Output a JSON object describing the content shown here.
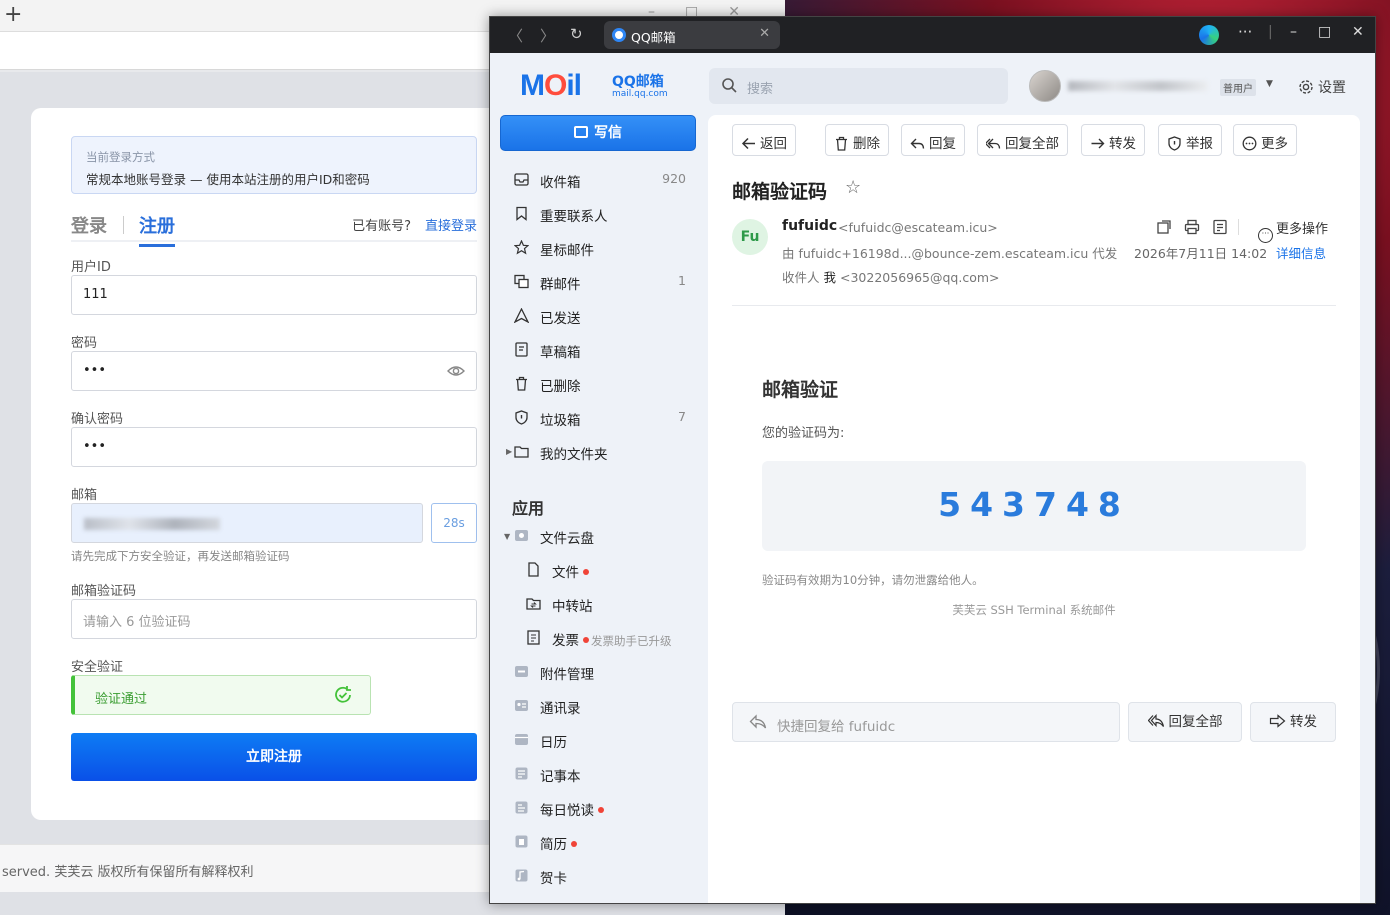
{
  "register": {
    "login_mode_title": "当前登录方式",
    "login_mode_desc": "常规本地账号登录 — 使用本站注册的用户ID和密码",
    "tab_login": "登录",
    "tab_register": "注册",
    "have_account": "已有账号?",
    "direct_login": "直接登录",
    "userid_label": "用户ID",
    "userid_value": "111",
    "password_label": "密码",
    "password_value": "•••",
    "confirm_label": "确认密码",
    "confirm_value": "•••",
    "email_label": "邮箱",
    "resend_countdown": "28s",
    "email_hint": "请先完成下方安全验证，再发送邮箱验证码",
    "code_label": "邮箱验证码",
    "code_placeholder": "请输入 6 位验证码",
    "security_label": "安全验证",
    "verify_status": "验证通过",
    "submit_label": "立即注册",
    "footer": "served. 芙芙云 版权所有保留所有解释权利"
  },
  "browser": {
    "tab_title": "QQ邮箱"
  },
  "header": {
    "logo_main": "MOil",
    "logo_brand": "QQ邮箱",
    "logo_domain": "mail.qq.com",
    "search_placeholder": "搜索",
    "user_level": "普用户",
    "settings_label": "设置"
  },
  "sidebar": {
    "compose_label": "写信",
    "items": [
      {
        "label": "收件箱",
        "count": "920"
      },
      {
        "label": "重要联系人",
        "count": ""
      },
      {
        "label": "星标邮件",
        "count": ""
      },
      {
        "label": "群邮件",
        "count": "1"
      },
      {
        "label": "已发送",
        "count": ""
      },
      {
        "label": "草稿箱",
        "count": ""
      },
      {
        "label": "已删除",
        "count": ""
      },
      {
        "label": "垃圾箱",
        "count": "7"
      },
      {
        "label": "我的文件夹",
        "count": ""
      }
    ],
    "apps_title": "应用",
    "apps": [
      {
        "label": "文件云盘"
      },
      {
        "label": "文件"
      },
      {
        "label": "中转站"
      },
      {
        "label": "发票",
        "note": "发票助手已升级"
      },
      {
        "label": "附件管理"
      },
      {
        "label": "通讯录"
      },
      {
        "label": "日历"
      },
      {
        "label": "记事本"
      },
      {
        "label": "每日悦读"
      },
      {
        "label": "简历"
      },
      {
        "label": "贺卡"
      }
    ]
  },
  "toolbar": {
    "back": "返回",
    "delete": "删除",
    "reply": "回复",
    "reply_all": "回复全部",
    "forward": "转发",
    "report": "举报",
    "more": "更多"
  },
  "mail": {
    "subject": "邮箱验证码",
    "sender_initials": "Fu",
    "sender_name": "fufuidc",
    "sender_addr": "<fufuidc@escateam.icu>",
    "via": "由 fufuidc+16198d...@bounce-zem.escateam.icu 代发",
    "to_label": "收件人",
    "to_me": "我",
    "to_addr": "<3022056965@qq.com>",
    "date": "2026年7月11日 14:02",
    "detail": "详细信息",
    "more_actions": "更多操作",
    "body_title": "邮箱验证",
    "body_desc": "您的验证码为:",
    "code": "543748",
    "expiry_note": "验证码有效期为10分钟，请勿泄露给他人。",
    "signature": "芙芙云 SSH Terminal 系统邮件",
    "quick_reply_placeholder": "快捷回复给 fufuidc",
    "reply_all": "回复全部",
    "forward": "转发"
  }
}
